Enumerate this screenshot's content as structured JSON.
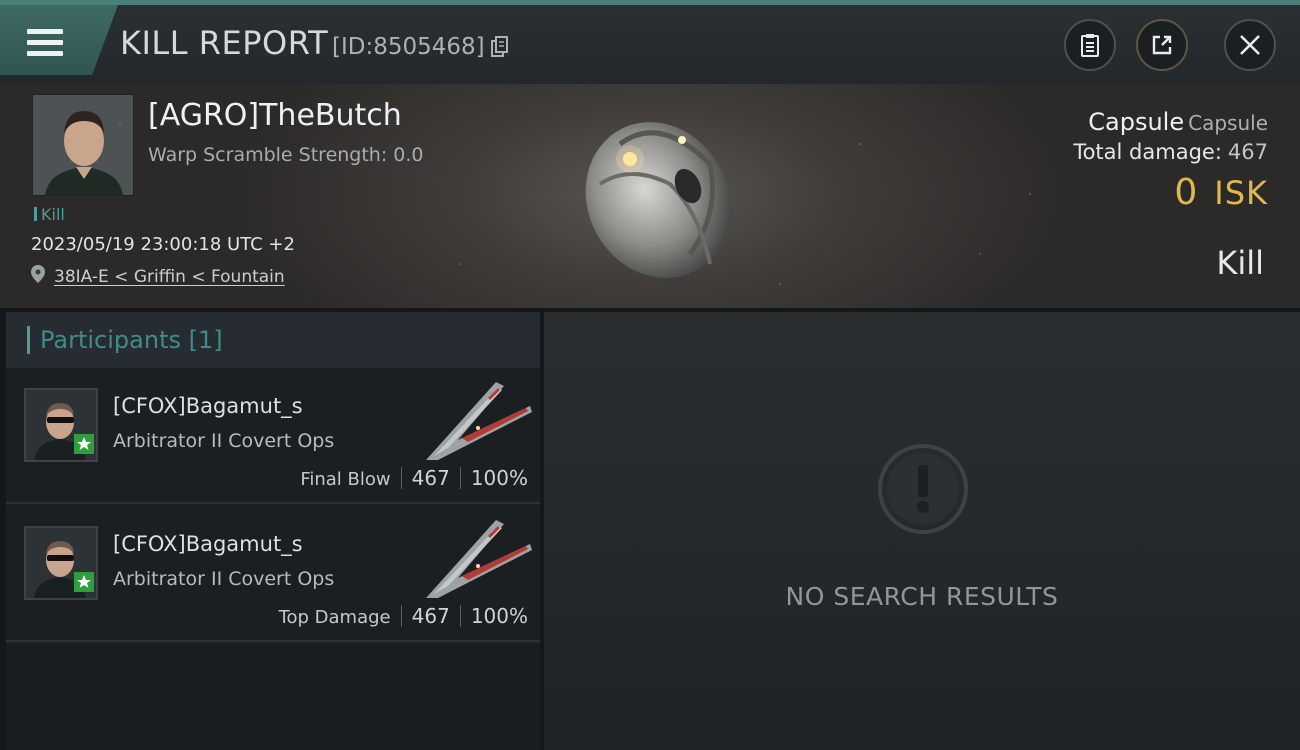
{
  "header": {
    "title": "KILL REPORT",
    "report_id": "[ID:8505468]"
  },
  "victim": {
    "name": "[AGRO]TheButch",
    "warp_scramble": "Warp Scramble Strength: 0.0",
    "kill_tag": "Kill",
    "timestamp": "2023/05/19 23:00:18 UTC +2",
    "location": "38IA-E < Griffin < Fountain",
    "ship_name": "Capsule",
    "ship_class": "Capsule",
    "total_damage_label": "Total damage:",
    "total_damage": "467",
    "isk_value": "0",
    "isk_unit": "ISK",
    "result": "Kill"
  },
  "participants": {
    "title": "Participants [1]",
    "rows": [
      {
        "name": "[CFOX]Bagamut_s",
        "ship": "Arbitrator II Covert Ops",
        "role": "Final Blow",
        "damage": "467",
        "percent": "100%"
      },
      {
        "name": "[CFOX]Bagamut_s",
        "ship": "Arbitrator II Covert Ops",
        "role": "Top Damage",
        "damage": "467",
        "percent": "100%"
      }
    ]
  },
  "results": {
    "empty_text": "NO SEARCH RESULTS"
  },
  "colors": {
    "accent": "#4f9d98",
    "isk": "#e0b94a",
    "badge": "#2f9e3e"
  }
}
